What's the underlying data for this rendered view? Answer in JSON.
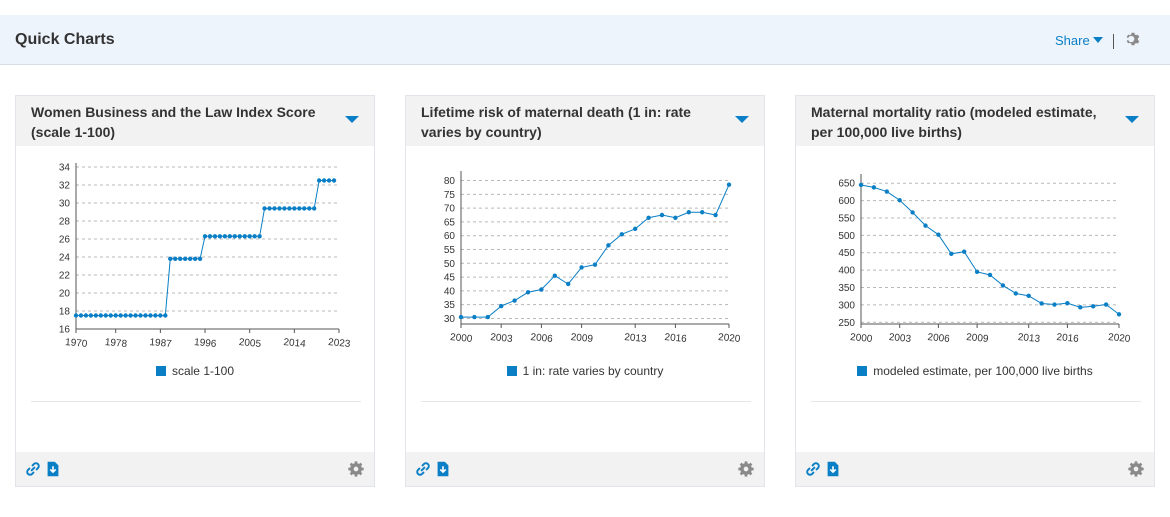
{
  "header": {
    "title": "Quick Charts",
    "share_label": "Share"
  },
  "colors": {
    "series": "#0a7fc6",
    "accent": "#0a7fc6"
  },
  "icons": {
    "link": "link-icon",
    "download": "download-icon",
    "settings": "gear-icon",
    "dropdown": "chevron-down-icon"
  },
  "chart_data": [
    {
      "type": "line",
      "title": "Women Business and the Law Index Score (scale 1-100)",
      "series": [
        {
          "name": "scale 1-100",
          "x": [
            1970,
            1971,
            1972,
            1973,
            1974,
            1975,
            1976,
            1977,
            1978,
            1979,
            1980,
            1981,
            1982,
            1983,
            1984,
            1985,
            1986,
            1987,
            1988,
            1989,
            1990,
            1991,
            1992,
            1993,
            1994,
            1995,
            1996,
            1997,
            1998,
            1999,
            2000,
            2001,
            2002,
            2003,
            2004,
            2005,
            2006,
            2007,
            2008,
            2009,
            2010,
            2011,
            2012,
            2013,
            2014,
            2015,
            2016,
            2017,
            2018,
            2019,
            2020,
            2021,
            2022
          ],
          "values": [
            17.5,
            17.5,
            17.5,
            17.5,
            17.5,
            17.5,
            17.5,
            17.5,
            17.5,
            17.5,
            17.5,
            17.5,
            17.5,
            17.5,
            17.5,
            17.5,
            17.5,
            17.5,
            17.5,
            23.8,
            23.8,
            23.8,
            23.8,
            23.8,
            23.8,
            23.8,
            26.3,
            26.3,
            26.3,
            26.3,
            26.3,
            26.3,
            26.3,
            26.3,
            26.3,
            26.3,
            26.3,
            26.3,
            29.4,
            29.4,
            29.4,
            29.4,
            29.4,
            29.4,
            29.4,
            29.4,
            29.4,
            29.4,
            29.4,
            32.5,
            32.5,
            32.5,
            32.5
          ]
        }
      ],
      "xticks": [
        1970,
        1978,
        1987,
        1996,
        2005,
        2014,
        2023
      ],
      "yticks": [
        16,
        18,
        20,
        22,
        24,
        26,
        28,
        30,
        32,
        34
      ],
      "xlim": [
        1970,
        2023
      ],
      "ylim": [
        16,
        34
      ],
      "grid": true,
      "legend": "bottom"
    },
    {
      "type": "line",
      "title": "Lifetime risk of maternal death (1 in: rate varies by country)",
      "series": [
        {
          "name": "1 in: rate varies by country",
          "x": [
            2000,
            2001,
            2002,
            2003,
            2004,
            2005,
            2006,
            2007,
            2008,
            2009,
            2010,
            2011,
            2012,
            2013,
            2014,
            2015,
            2016,
            2017,
            2018,
            2019,
            2020
          ],
          "values": [
            30.5,
            30.5,
            30.5,
            34.5,
            36.5,
            39.5,
            40.5,
            45.5,
            42.5,
            48.5,
            49.5,
            56.5,
            60.5,
            62.5,
            66.5,
            67.5,
            66.5,
            68.5,
            68.5,
            67.5,
            78.5
          ]
        }
      ],
      "xticks": [
        2000,
        2003,
        2006,
        2009,
        2013,
        2016,
        2020
      ],
      "yticks": [
        30,
        35,
        40,
        45,
        50,
        55,
        60,
        65,
        70,
        75,
        80
      ],
      "xlim": [
        2000,
        2020
      ],
      "ylim": [
        28,
        82
      ],
      "grid": true,
      "legend": "bottom"
    },
    {
      "type": "line",
      "title": "Maternal mortality ratio (modeled estimate, per 100,000 live births)",
      "series": [
        {
          "name": "modeled estimate, per 100,000 live births",
          "x": [
            2000,
            2001,
            2002,
            2003,
            2004,
            2005,
            2006,
            2007,
            2008,
            2009,
            2010,
            2011,
            2012,
            2013,
            2014,
            2015,
            2016,
            2017,
            2018,
            2019,
            2020
          ],
          "values": [
            645,
            638,
            626,
            601,
            566,
            528,
            502,
            447,
            453,
            395,
            386,
            356,
            333,
            326,
            304,
            301,
            305,
            293,
            296,
            301,
            273
          ]
        }
      ],
      "xticks": [
        2000,
        2003,
        2006,
        2009,
        2013,
        2016,
        2020
      ],
      "yticks": [
        250,
        300,
        350,
        400,
        450,
        500,
        550,
        600,
        650
      ],
      "xlim": [
        2000,
        2020
      ],
      "ylim": [
        245,
        665
      ],
      "grid": true,
      "legend": "bottom"
    }
  ]
}
